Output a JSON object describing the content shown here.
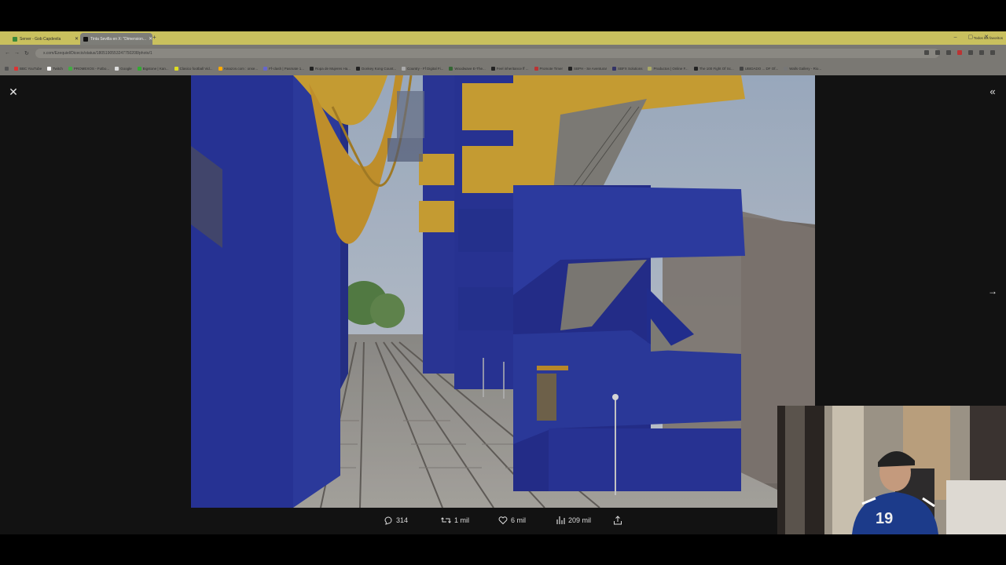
{
  "tabs": [
    {
      "label": "Server - Gob Capdevila"
    },
    {
      "label": "Tinta Sevilla en X: \"Dimension..."
    }
  ],
  "address": {
    "url": "x.com/Ezequiel/Dicecio/status/1805190553247750208/photo/1"
  },
  "bookmarks": [
    {
      "label": "BBC YouTube",
      "color": "#d33"
    },
    {
      "label": "Twitch",
      "color": "#fff"
    },
    {
      "label": "PROMEXOS - Futbo...",
      "color": "#4a4"
    },
    {
      "label": "Google",
      "color": "#ddd"
    },
    {
      "label": "Bigstone | Kan...",
      "color": "#3a3"
    },
    {
      "label": "Clasico football Vid...",
      "color": "#dd2"
    },
    {
      "label": "Amazon.com : onse...",
      "color": "#fa0"
    },
    {
      "label": "Ff-clash | Pasmate 1...",
      "color": "#66c"
    },
    {
      "label": "Ropa de Mujeres Ha...",
      "color": "#222"
    },
    {
      "label": "Donkey Kong Count...",
      "color": "#222"
    },
    {
      "label": "Country - Ff Digital Fi...",
      "color": "#aaa"
    },
    {
      "label": "Woodwave E-The...",
      "color": "#363"
    },
    {
      "label": "Feel inheritance ff ...",
      "color": "#222"
    },
    {
      "label": "Promote Timer",
      "color": "#b33"
    },
    {
      "label": "SBPH - Se Aventura!",
      "color": "#222"
    },
    {
      "label": "SBFX Solutions",
      "color": "#336"
    },
    {
      "label": "Productos | Online F...",
      "color": "#aa6"
    },
    {
      "label": "The 100 Fight Of Sc...",
      "color": "#222"
    },
    {
      "label": "UBIDADO ... DF Of...",
      "color": "#444"
    },
    {
      "label": "Walls Gallery - Rio...",
      "color": "#777"
    }
  ],
  "bookmarks_all": "Todos los favoritos",
  "stats": {
    "replies": "314",
    "reposts": "1 mil",
    "likes": "6 mil",
    "views": "209 mil"
  },
  "icons": {
    "close": "close-icon",
    "collapse": "double-chevron-icon",
    "next": "arrow-right-icon",
    "reply": "comment-icon",
    "repost": "repost-icon",
    "like": "heart-icon",
    "views": "bar-chart-icon",
    "share": "share-icon"
  },
  "colors": {
    "brand_blue": "#2c3aa8",
    "brand_yellow": "#e0b13a"
  }
}
